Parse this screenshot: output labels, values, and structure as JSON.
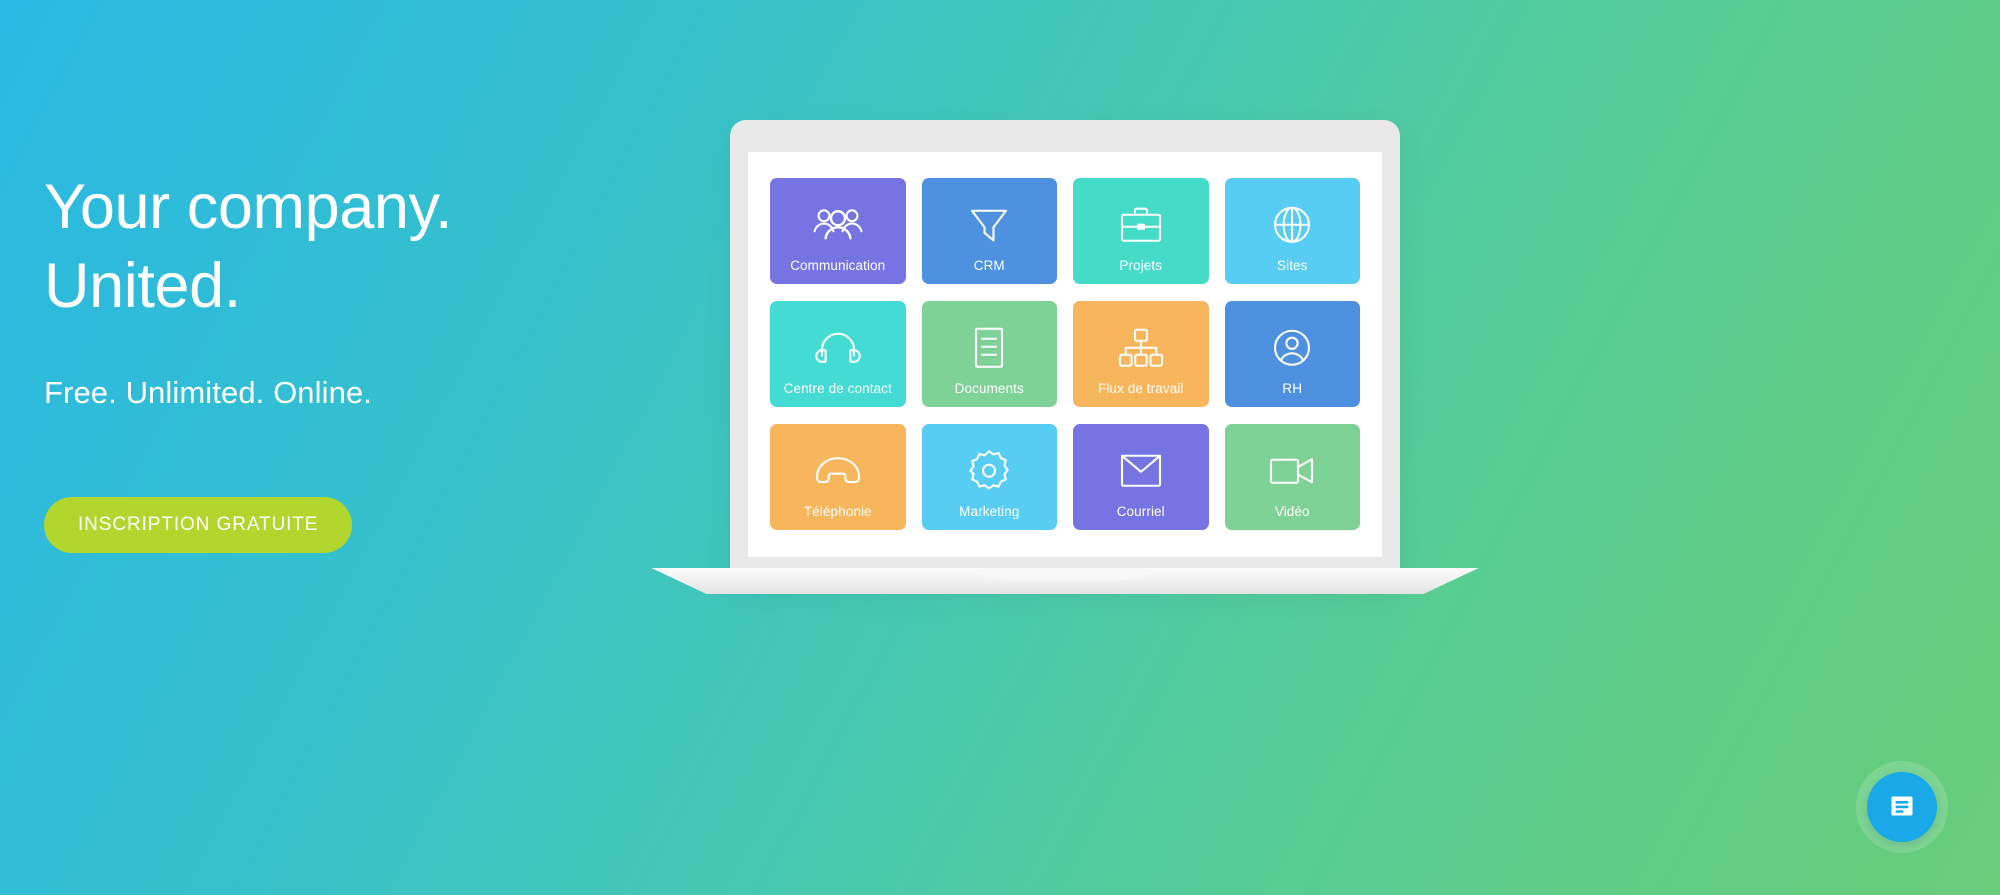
{
  "hero": {
    "headline_line1": "Your company.",
    "headline_line2": "United.",
    "subhead": "Free. Unlimited. Online.",
    "cta_label": "INSCRIPTION GRATUITE",
    "cta_color": "#b2d62e",
    "gradient_from": "#2ab9e2",
    "gradient_to": "#69cd7b"
  },
  "device": {
    "type": "laptop",
    "bezel_color": "#e9e9e9",
    "screen_color": "#ffffff"
  },
  "tiles": [
    {
      "label": "Communication",
      "icon": "people-group-icon",
      "color": "#7673e3"
    },
    {
      "label": "CRM",
      "icon": "funnel-icon",
      "color": "#4d91e0"
    },
    {
      "label": "Projets",
      "icon": "briefcase-icon",
      "color": "#44dbc8"
    },
    {
      "label": "Sites",
      "icon": "globe-icon",
      "color": "#57cdf4"
    },
    {
      "label": "Centre de contact",
      "icon": "headset-icon",
      "color": "#44dbd4"
    },
    {
      "label": "Documents",
      "icon": "document-icon",
      "color": "#7ed295"
    },
    {
      "label": "Flux de travail",
      "icon": "org-chart-icon",
      "color": "#f7b55c"
    },
    {
      "label": "RH",
      "icon": "user-circle-icon",
      "color": "#4d90e0"
    },
    {
      "label": "Téléphonie",
      "icon": "phone-handset-icon",
      "color": "#f7b55c"
    },
    {
      "label": "Marketing",
      "icon": "gear-icon",
      "color": "#57cdf4"
    },
    {
      "label": "Courriel",
      "icon": "envelope-icon",
      "color": "#7673e3"
    },
    {
      "label": "Vidéo",
      "icon": "video-camera-icon",
      "color": "#7ed295"
    }
  ],
  "chat_widget": {
    "icon": "chat-document-icon",
    "color": "#19a9e8"
  }
}
